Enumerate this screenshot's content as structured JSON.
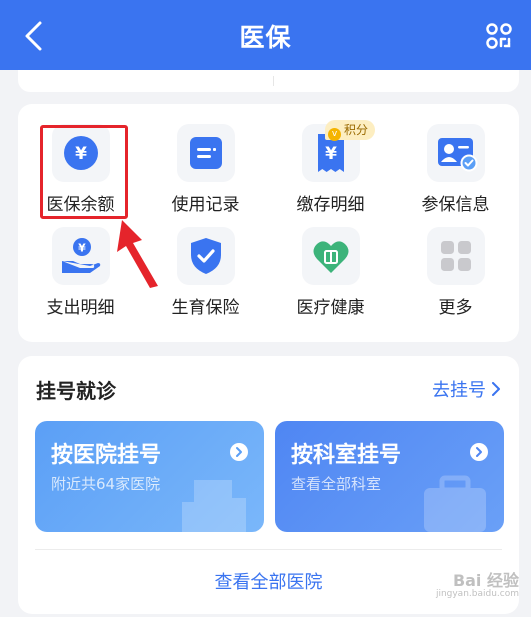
{
  "header": {
    "title": "医保",
    "back_icon": "chevron-left-icon",
    "scan_icon": "scan-icon",
    "background": "#3a74f0"
  },
  "services": {
    "items": [
      {
        "label": "医保余额",
        "icon": "yuan-coin-icon"
      },
      {
        "label": "使用记录",
        "icon": "record-icon"
      },
      {
        "label": "缴存明细",
        "icon": "receipt-icon"
      },
      {
        "label": "参保信息",
        "icon": "id-card-icon"
      },
      {
        "label": "支出明细",
        "icon": "hand-coin-icon"
      },
      {
        "label": "生育保险",
        "icon": "shield-check-icon"
      },
      {
        "label": "医疗健康",
        "icon": "health-heart-icon"
      },
      {
        "label": "更多",
        "icon": "more-grid-icon"
      }
    ],
    "badge": "积分",
    "badge_coin": "v"
  },
  "booking": {
    "title": "挂号就诊",
    "link": "去挂号",
    "tiles": [
      {
        "title": "按医院挂号",
        "subtitle": "附近共64家医院"
      },
      {
        "title": "按科室挂号",
        "subtitle": "查看全部科室"
      }
    ],
    "view_all": "查看全部医院"
  },
  "watermark": {
    "brand": "Bai 经验",
    "site": "jingyan.baidu.com"
  },
  "colors": {
    "accent": "#3a74f0",
    "highlight": "#e5242b"
  }
}
